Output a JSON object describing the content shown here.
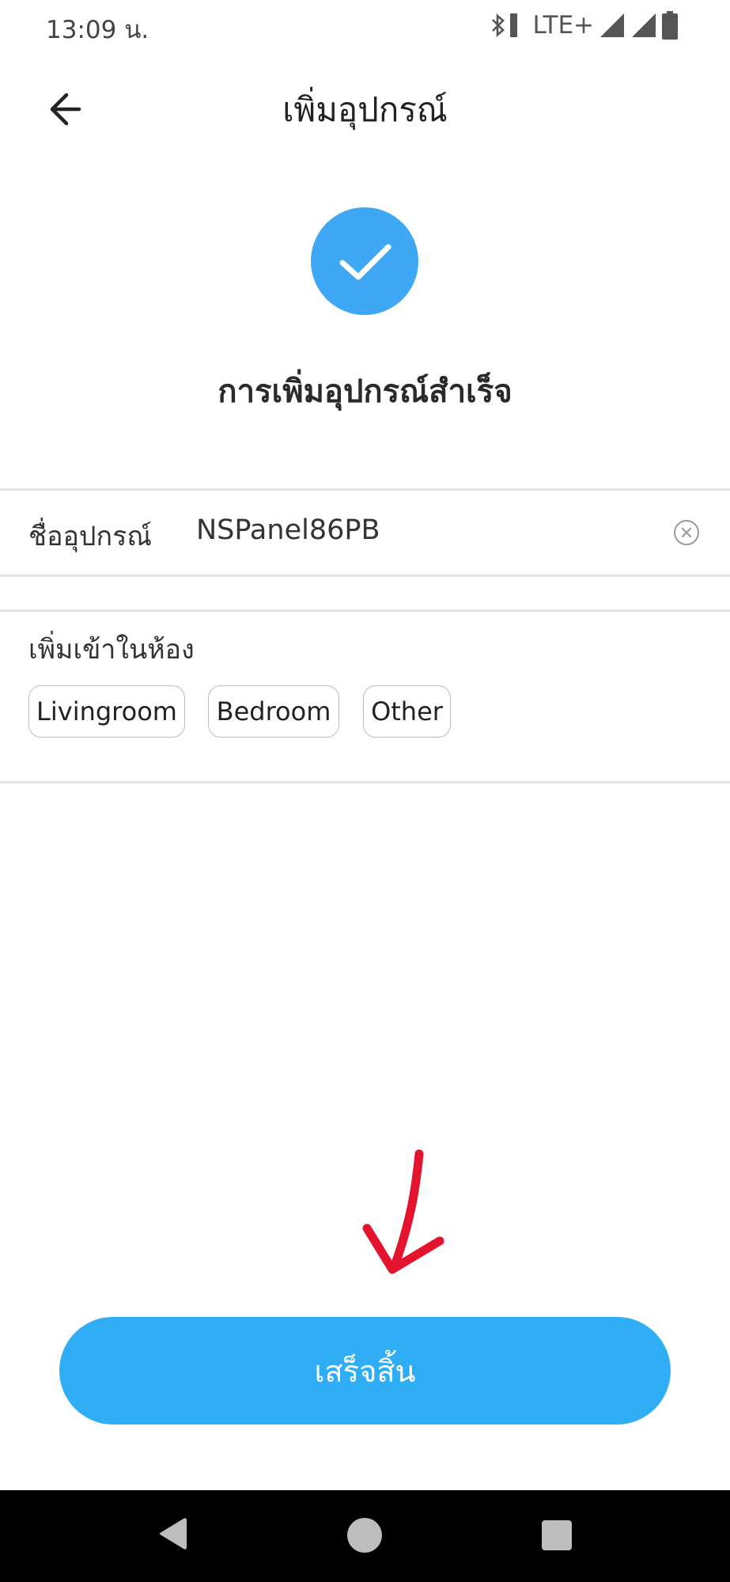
{
  "status_bar": {
    "time": "13:09 น.",
    "network": "LTE+",
    "icons": [
      "bluetooth-icon",
      "signal-icon",
      "signal-icon",
      "battery-icon"
    ]
  },
  "header": {
    "title": "เพิ่มอุปกรณ์",
    "back_icon": "arrow-left-icon"
  },
  "success": {
    "message": "การเพิ่มอุปกรณ์สำเร็จ",
    "icon": "check-icon",
    "icon_color": "#3fa8f5"
  },
  "device_name": {
    "label": "ชื่ออุปกรณ์",
    "value": "NSPanel86PB",
    "clear_icon": "clear-icon"
  },
  "room": {
    "label": "เพิ่มเข้าในห้อง",
    "options": [
      "Livingroom",
      "Bedroom",
      "Other"
    ]
  },
  "finish_button": {
    "label": "เสร็จสิ้น",
    "color": "#2fadf5"
  },
  "annotation": {
    "arrow_color": "#e5142e"
  },
  "nav_bar": {
    "icons": [
      "nav-back-icon",
      "nav-home-icon",
      "nav-recents-icon"
    ]
  }
}
